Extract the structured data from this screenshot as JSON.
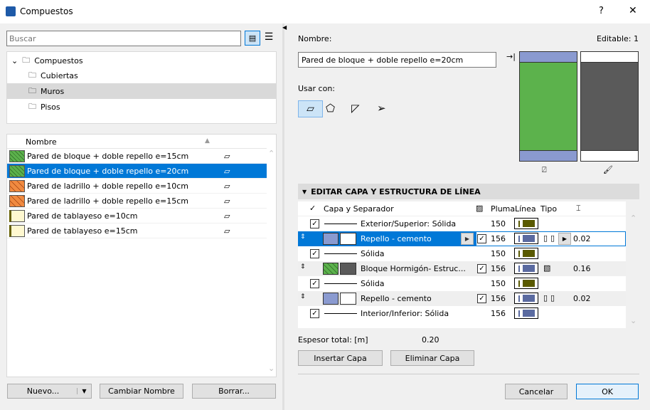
{
  "window": {
    "title": "Compuestos",
    "help": "?",
    "close": "✕"
  },
  "search": {
    "placeholder": "Buscar"
  },
  "tree": {
    "root": "Compuestos",
    "children": [
      "Cubiertas",
      "Muros",
      "Pisos"
    ],
    "selected": "Muros"
  },
  "list": {
    "header": "Nombre",
    "items": [
      {
        "name": "Pared de bloque + doble repello e=15cm",
        "swatch": "green"
      },
      {
        "name": "Pared de bloque + doble repello e=20cm",
        "swatch": "green",
        "selected": true
      },
      {
        "name": "Pared de ladrillo + doble repello e=10cm",
        "swatch": "orange"
      },
      {
        "name": "Pared de ladrillo + doble repello e=15cm",
        "swatch": "orange"
      },
      {
        "name": "Pared de tablayeso e=10cm",
        "swatch": "yellow"
      },
      {
        "name": "Pared de tablayeso e=15cm",
        "swatch": "yellow"
      }
    ]
  },
  "left_buttons": {
    "new": "Nuevo...",
    "rename": "Cambiar Nombre",
    "delete": "Borrar..."
  },
  "right": {
    "name_label": "Nombre:",
    "editable": "Editable: 1",
    "name_value": "Pared de bloque + doble repello e=20cm",
    "use_with": "Usar con:",
    "section": "EDITAR CAPA Y ESTRUCTURA DE LÍNEA",
    "columns": {
      "layer": "Capa y Separador",
      "pen": "Pluma",
      "line": "Línea",
      "type": "Tipo"
    },
    "rows": [
      {
        "kind": "sep",
        "label": "Exterior/Superior: Sólida",
        "pen": "150"
      },
      {
        "kind": "layer",
        "label": "Repello - cemento",
        "pen": "156",
        "thick": "0.02",
        "selected": true
      },
      {
        "kind": "sep",
        "label": "Sólida",
        "pen": "150"
      },
      {
        "kind": "layer",
        "label": "Bloque Hormigón- Estruc...",
        "pen": "156",
        "thick": "0.16"
      },
      {
        "kind": "sep",
        "label": "Sólida",
        "pen": "150"
      },
      {
        "kind": "layer",
        "label": "Repello - cemento",
        "pen": "156",
        "thick": "0.02"
      },
      {
        "kind": "sep",
        "label": "Interior/Inferior: Sólida",
        "pen": "156"
      }
    ],
    "total_label": "Espesor total: [m]",
    "total_value": "0.20",
    "insert": "Insertar Capa",
    "remove": "Eliminar Capa",
    "cancel": "Cancelar",
    "ok": "OK"
  },
  "colors": {
    "accent": "#0078d7",
    "green": "#5cb24c",
    "dark": "#5a5a5a",
    "pen150": "#5a5a00",
    "pen156": "#5a6aa0"
  }
}
